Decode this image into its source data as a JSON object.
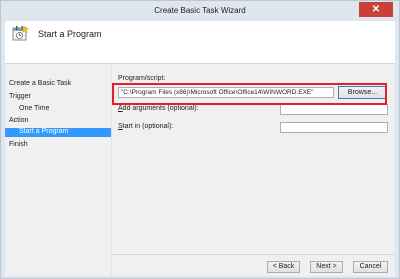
{
  "window": {
    "title": "Create Basic Task Wizard",
    "close_glyph": "✕"
  },
  "header": {
    "title": "Start a Program",
    "icon": "task-wizard-icon"
  },
  "nav": {
    "items": [
      {
        "label": "Create a Basic Task",
        "selected": false
      },
      {
        "label": "Trigger",
        "selected": false
      },
      {
        "label": "One Time",
        "selected": false
      },
      {
        "label": "Action",
        "selected": false
      },
      {
        "label": "Start a Program",
        "selected": true
      },
      {
        "label": "Finish",
        "selected": false
      }
    ]
  },
  "form": {
    "program_label": "Program/script:",
    "program_value": "\"C:\\Program Files (x86)\\Microsoft Office\\Office14\\WINWORD.EXE\"",
    "browse_label": "Browse...",
    "args_label_u": "A",
    "args_label_rest": "dd arguments (optional):",
    "args_value": "",
    "startin_label_u": "S",
    "startin_label_rest": "tart in (optional):",
    "startin_value": ""
  },
  "buttons": {
    "back": "< Back",
    "back_u": "B",
    "next": "Next >",
    "next_u": "N",
    "cancel": "Cancel"
  },
  "colors": {
    "selection": "#3399ff",
    "highlight_box": "#e2212b",
    "close": "#c7403a"
  }
}
